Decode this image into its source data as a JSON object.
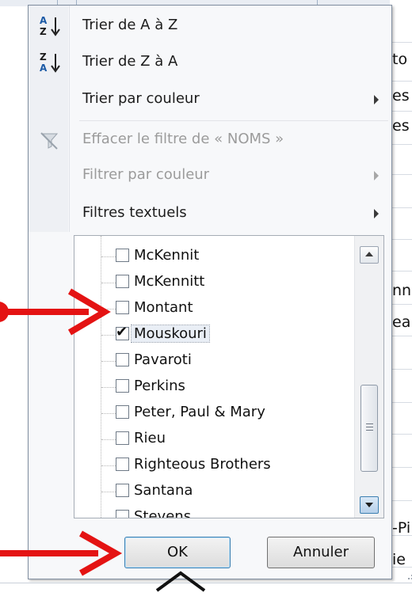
{
  "sheet": {
    "cells": [
      {
        "text": "to"
      },
      {
        "text": "es"
      },
      {
        "text": "es"
      },
      {
        "text": "nn"
      },
      {
        "text": "ea"
      },
      {
        "text": "-Pi"
      },
      {
        "text": "ie"
      }
    ]
  },
  "menu": {
    "sort_az": "Trier de A à Z",
    "sort_za": "Trier de Z à A",
    "sort_by_color": "Trier par couleur",
    "clear_filter": "Effacer le filtre de « NOMS »",
    "filter_by_color": "Filtrer par couleur",
    "text_filters": "Filtres textuels"
  },
  "list": {
    "items": [
      {
        "label": "McKennit",
        "checked": false
      },
      {
        "label": "McKennitt",
        "checked": false
      },
      {
        "label": "Montant",
        "checked": false
      },
      {
        "label": "Mouskouri",
        "checked": true
      },
      {
        "label": "Pavaroti",
        "checked": false
      },
      {
        "label": "Perkins",
        "checked": false
      },
      {
        "label": "Peter, Paul & Mary",
        "checked": false
      },
      {
        "label": "Rieu",
        "checked": false
      },
      {
        "label": "Righteous Brothers",
        "checked": false
      },
      {
        "label": "Santana",
        "checked": false
      },
      {
        "label": "Stevens",
        "checked": false
      }
    ],
    "scroll_position": 0.68
  },
  "buttons": {
    "ok": "OK",
    "cancel": "Annuler"
  },
  "colors": {
    "annotation_arrow": "#e41313",
    "menu_border": "#7f8d9f",
    "ok_border": "#3c7fb1"
  },
  "icons": {
    "sort_az": "sort-ascending-icon",
    "sort_za": "sort-descending-icon",
    "clear_filter": "clear-filter-icon"
  }
}
